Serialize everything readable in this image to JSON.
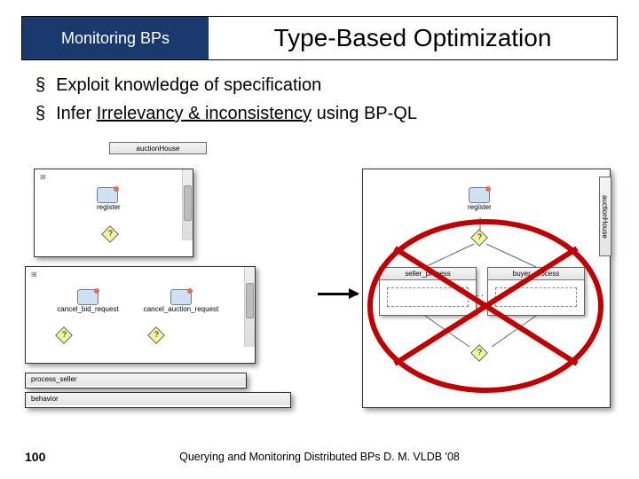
{
  "header": {
    "context": "Monitoring  BPs",
    "title": "Type-Based Optimization"
  },
  "bullets": [
    {
      "text_pre": "Exploit knowledge of specification",
      "underlined": "",
      "text_post": ""
    },
    {
      "text_pre": "Infer ",
      "underlined": "Irrelevancy & inconsistency",
      "text_post": " using BP-QL"
    }
  ],
  "left_diagram": {
    "top_tab": "auctionHouse",
    "box_a": {
      "icon_label": "register"
    },
    "box_b": {
      "left_label": "cancel_bid_request",
      "right_label": "cancel_auction_request"
    },
    "footer_tabs": [
      "process_seller",
      "behavior"
    ]
  },
  "right_diagram": {
    "vlabel": "auctionHouse",
    "register": "register",
    "seller": "seller_process",
    "buyer": "buyer_process",
    "dots": ". . ."
  },
  "footer": {
    "page": "100",
    "text": "Querying and Monitoring Distributed BPs D. M. VLDB '08"
  }
}
